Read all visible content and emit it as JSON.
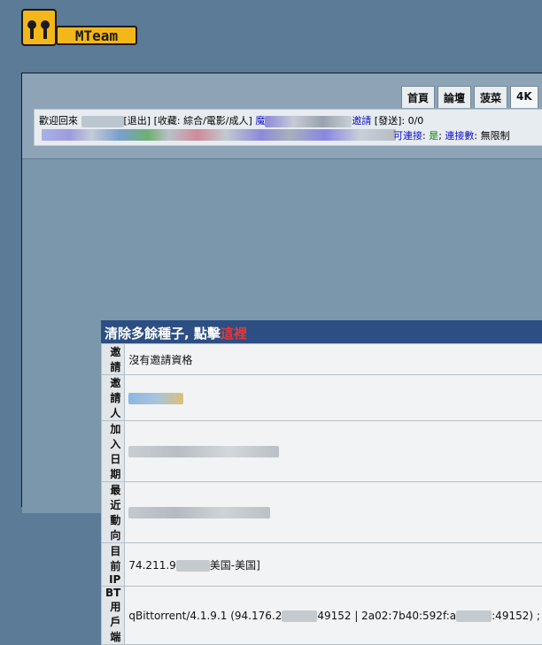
{
  "header": {
    "logo": "MTeam"
  },
  "nav": {
    "tabs": [
      {
        "label": "首頁"
      },
      {
        "label": "論壇"
      },
      {
        "label": "菠菜"
      },
      {
        "label": "4K"
      }
    ]
  },
  "info_bar": {
    "welcome": "歡迎回來",
    "logout": "退出",
    "bracket_close": "]",
    "favorites_prefix": "[收藏: ",
    "favorites": "綜合/電影/成人",
    "favorites_suffix": "] ",
    "magic_partial": "魔",
    "invite_partial": "邀請",
    "sent_label": " [發送]: 0/0",
    "connectable_partial": "可連接",
    "connectable_colon": ": ",
    "connectable_value": "是",
    "connections_label": "連接數",
    "connections_value": ": 無限制"
  },
  "user_panel": {
    "header_text": "清除多餘種子, 點擊",
    "header_link": "這裡",
    "rows": [
      {
        "label": "邀請",
        "value": "沒有邀請資格"
      },
      {
        "label": "邀請人",
        "value": ""
      },
      {
        "label": "加入日期",
        "value": ""
      },
      {
        "label": "最近動向",
        "value": ""
      },
      {
        "label": "目前IP",
        "value": "74.211.9",
        "value_suffix": "美国-美国]"
      },
      {
        "label": "BT用戶端",
        "value": "qBittorrent/4.1.9.1 (94.176.2",
        "value_mid": "49152 | 2a02:7b40:592f:a",
        "value_suffix": ":49152) ;"
      }
    ]
  },
  "colors": {
    "page_bg": "#5b7b97",
    "panel_header": "#2c4e82",
    "link_blue": "#1010c8",
    "link_red": "#e33a3a",
    "connectable_green": "#0c7d0c"
  }
}
